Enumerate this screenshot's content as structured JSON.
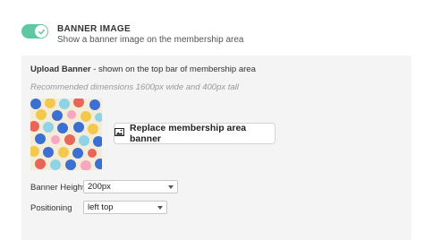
{
  "setting": {
    "enabled": true,
    "title": "BANNER IMAGE",
    "description": "Show a banner image on the membership area"
  },
  "upload": {
    "label_bold": "Upload Banner",
    "label_rest": " - shown on the top bar of membership area",
    "hint": "Recommended dimensions 1600px wide and 400px tall",
    "replace_button": "Replace membership area banner",
    "thumbnail_icon": "image-icon"
  },
  "banner_height": {
    "label": "Banner Height",
    "value": "200px"
  },
  "positioning": {
    "label": "Positioning",
    "value": "left top"
  },
  "colors": {
    "toggle_on": "#5ec9a0",
    "panel_bg": "#f4f4f4"
  }
}
